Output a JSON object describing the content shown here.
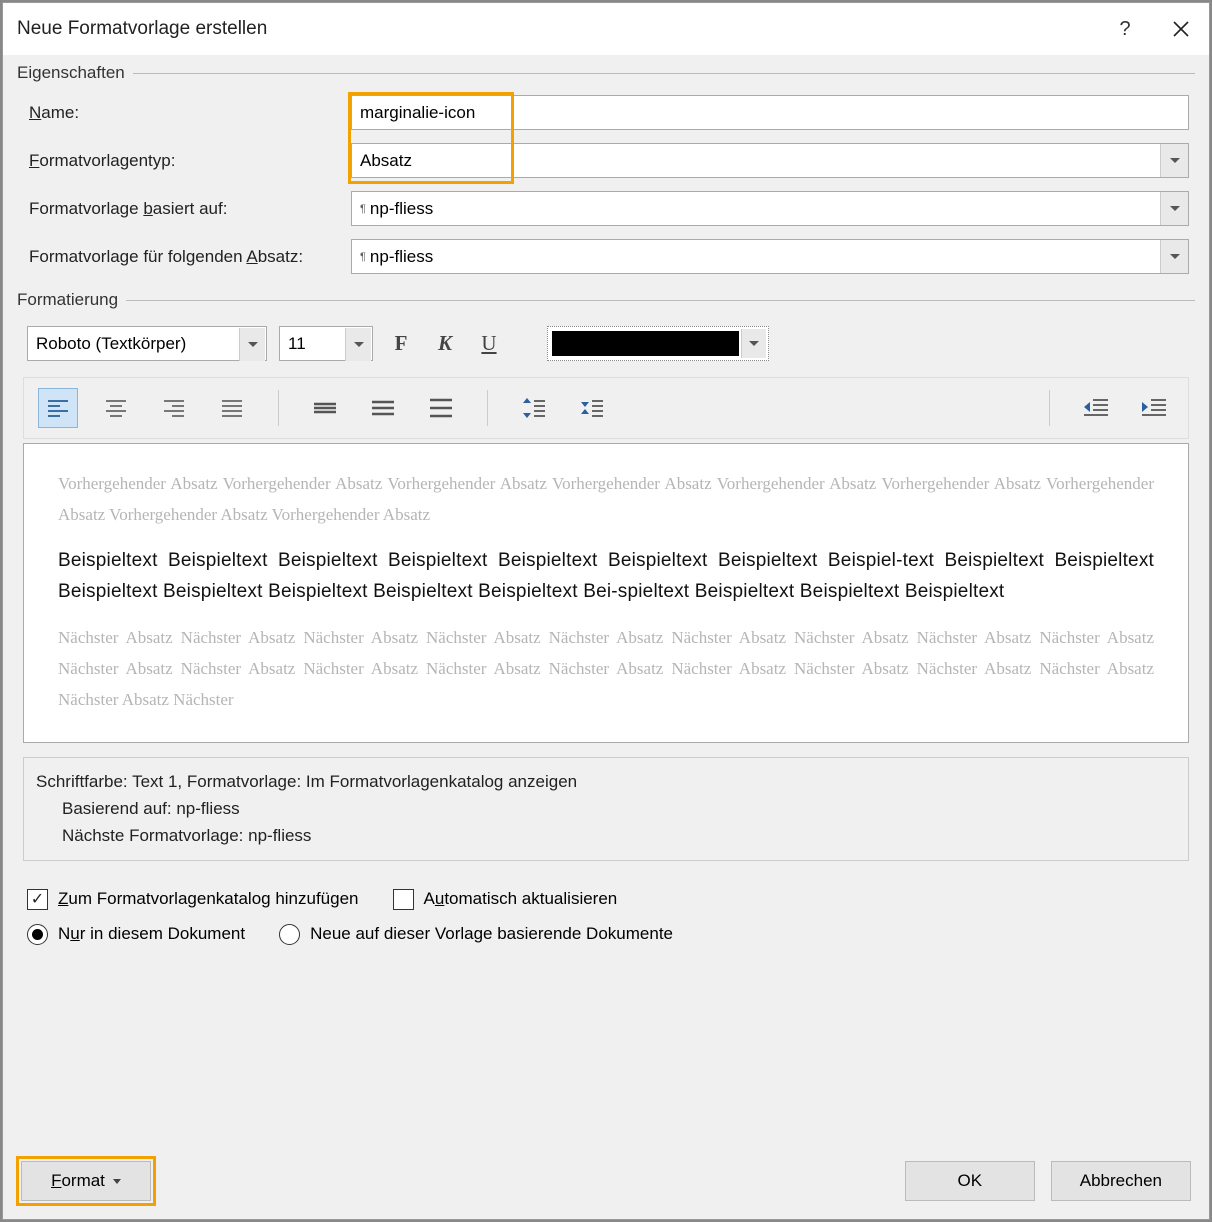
{
  "title": "Neue Formatvorlage erstellen",
  "groups": {
    "properties": "Eigenschaften",
    "formatting": "Formatierung"
  },
  "labels": {
    "name_pre": "",
    "name_u": "N",
    "name_post": "ame:",
    "type_u": "F",
    "type_post": "ormatvorlagentyp:",
    "based_pre": "Formatvorlage ",
    "based_u": "b",
    "based_post": "asiert auf:",
    "next_pre": "Formatvorlage für folgenden ",
    "next_u": "A",
    "next_post": "bsatz:"
  },
  "values": {
    "name": "marginalie-icon",
    "type": "Absatz",
    "based_on": "np-fliess",
    "next": "np-fliess",
    "font": "Roboto (Textkörper)",
    "size": "11"
  },
  "fmtbtns": {
    "bold": "F",
    "italic": "K",
    "underline": "U"
  },
  "preview": {
    "prev_para": "Vorhergehender Absatz Vorhergehender Absatz Vorhergehender Absatz Vorhergehender Absatz Vorhergehender Absatz Vorhergehender Absatz Vorhergehender Absatz Vorhergehender Absatz Vorhergehender Absatz",
    "sample": "Beispieltext Beispieltext Beispieltext Beispieltext Beispieltext Beispieltext Beispieltext Beispiel‑text Beispieltext Beispieltext Beispieltext Beispieltext Beispieltext Beispieltext Beispieltext Bei‑spieltext Beispieltext Beispieltext Beispieltext",
    "next_para": "Nächster Absatz Nächster Absatz Nächster Absatz Nächster Absatz Nächster Absatz Nächster Absatz Nächster Absatz Nächster Absatz Nächster Absatz Nächster Absatz Nächster Absatz Nächster Absatz Nächster Absatz Nächster Absatz Nächster Absatz Nächster Absatz Nächster Absatz Nächster Absatz Nächster Absatz Nächster"
  },
  "description": {
    "line1": "Schriftfarbe: Text 1, Formatvorlage: Im Formatvorlagenkatalog anzeigen",
    "line2": "Basierend auf: np-fliess",
    "line3": "Nächste Formatvorlage: np-fliess"
  },
  "checks": {
    "add_u": "Z",
    "add_post": "um Formatvorlagenkatalog hinzufügen",
    "auto_pre": "A",
    "auto_u": "u",
    "auto_post": "tomatisch aktualisieren",
    "only_pre": "N",
    "only_u": "u",
    "only_post": "r in diesem Dokument",
    "newtpl": "Neue auf dieser Vorlage basierende Dokumente"
  },
  "buttons": {
    "format_u": "F",
    "format_post": "ormat",
    "ok": "OK",
    "cancel": "Abbrechen"
  }
}
